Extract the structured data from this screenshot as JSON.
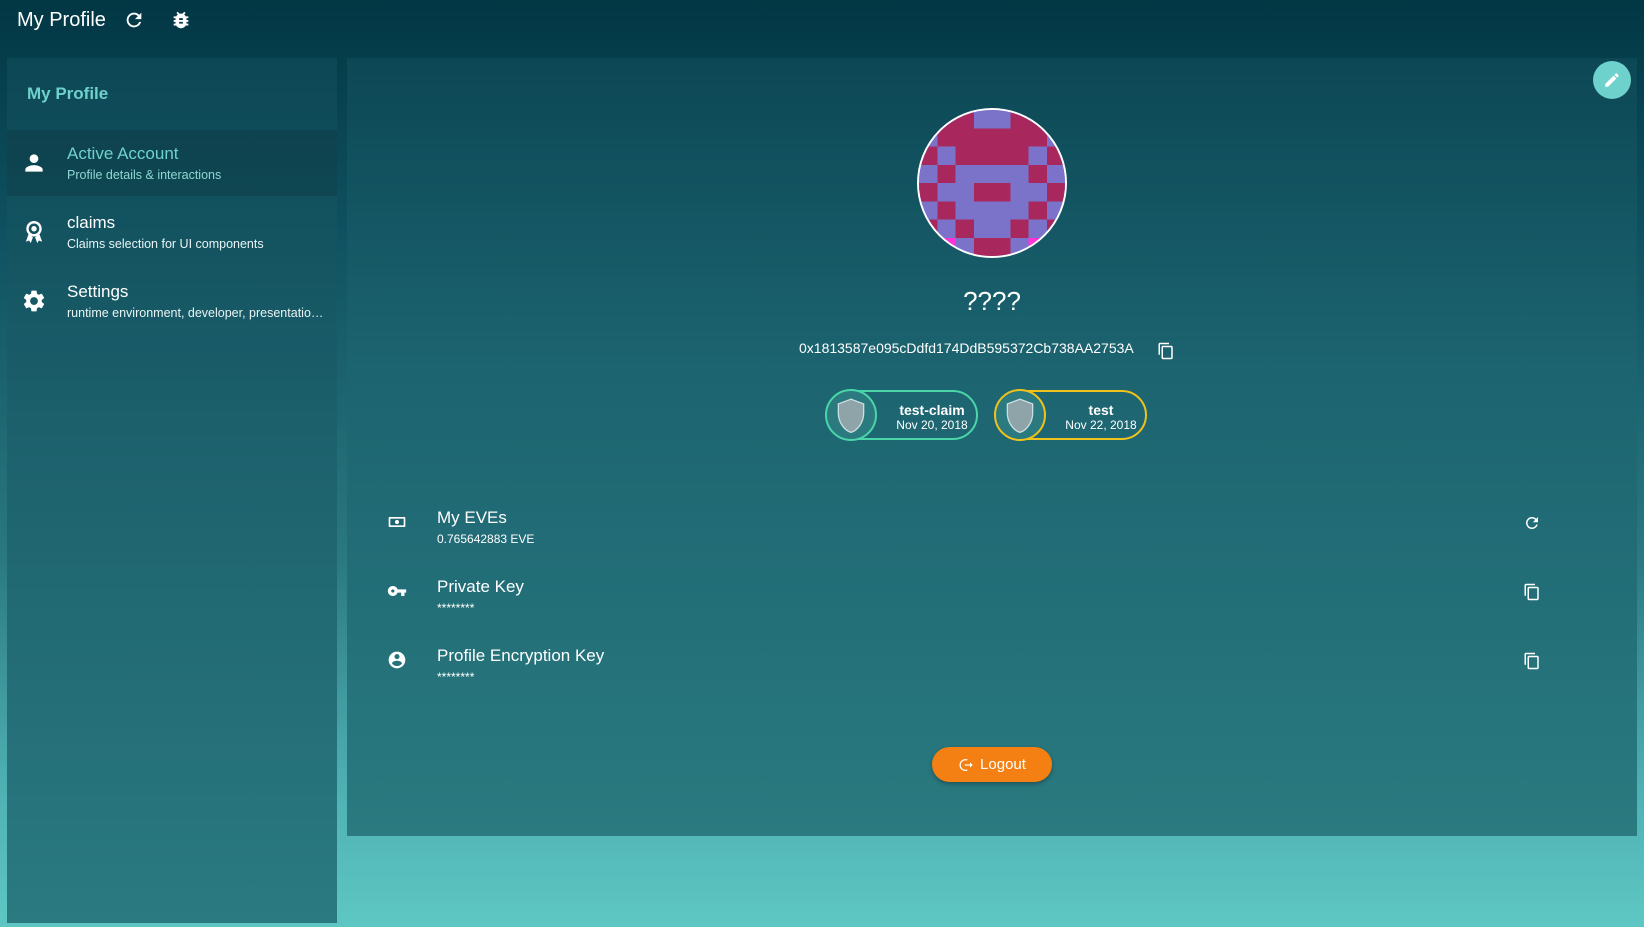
{
  "app": {
    "title": "My Profile",
    "icons": {
      "refresh": "refresh-icon",
      "debug": "bug-icon"
    }
  },
  "sidebar": {
    "header": "My Profile",
    "items": [
      {
        "title": "Active Account",
        "subtitle": "Profile details & interactions",
        "icon": "person-icon",
        "active": true
      },
      {
        "title": "claims",
        "subtitle": "Claims selection for UI components",
        "icon": "award-icon",
        "active": false
      },
      {
        "title": "Settings",
        "subtitle": "runtime environment, developer, presentation...",
        "icon": "gear-icon",
        "active": false
      }
    ]
  },
  "profile": {
    "name": "????",
    "address": "0x1813587e095cDdfd174DdB595372Cb738AA2753A",
    "claims": [
      {
        "name": "test-claim",
        "date": "Nov 20, 2018",
        "color": "#4ad6a8"
      },
      {
        "name": "test",
        "date": "Nov 22, 2018",
        "color": "#f1c21b"
      }
    ]
  },
  "details": [
    {
      "title": "My EVEs",
      "value": "0.765642883 EVE",
      "icon": "money-icon",
      "action": "refresh-icon"
    },
    {
      "title": "Private Key",
      "value": "********",
      "icon": "key-icon",
      "action": "copy-icon"
    },
    {
      "title": "Profile Encryption Key",
      "value": "********",
      "icon": "account-circle-icon",
      "action": "copy-icon"
    }
  ],
  "logout_label": "Logout",
  "colors": {
    "accent": "#6fd1cb",
    "logout": "#f47f12",
    "claim_green": "#4ad6a8",
    "claim_yellow": "#f1c21b"
  }
}
